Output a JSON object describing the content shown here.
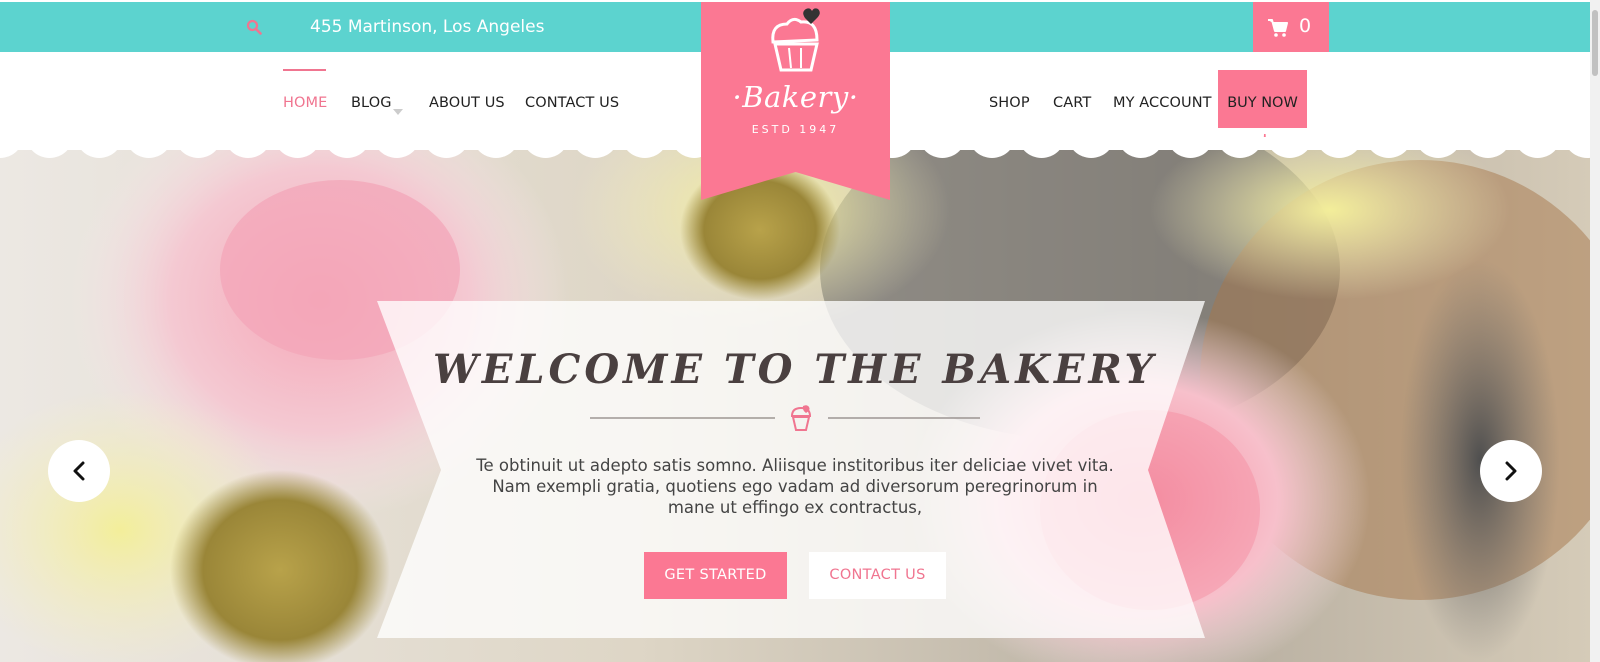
{
  "topbar": {
    "address": "455 Martinson, Los Angeles",
    "cart_count": "0",
    "bg_color": "#5cd3cf"
  },
  "nav": {
    "left": [
      "HOME",
      "BLOG",
      "ABOUT US",
      "CONTACT US"
    ],
    "right": [
      "SHOP",
      "CART",
      "MY ACCOUNT"
    ],
    "buy_now": "BUY NOW",
    "active": "HOME"
  },
  "logo": {
    "name": "·Bakery·",
    "estd": "ESTD 1947"
  },
  "hero": {
    "title": "WELCOME TO THE BAKERY",
    "text": "Te obtinuit ut adepto satis somno. Aliisque institoribus iter deliciae vivet vita. Nam exempli gratia, quotiens ego vadam ad diversorum peregrinorum in mane ut effingo ex contractus,",
    "primary_button": "GET STARTED",
    "secondary_button": "CONTACT US"
  },
  "colors": {
    "accent": "#fb7893",
    "teal": "#5cd3cf"
  },
  "icons": [
    "search-icon",
    "cart-icon",
    "cupcake-icon",
    "chevron-left-icon",
    "chevron-right-icon"
  ]
}
